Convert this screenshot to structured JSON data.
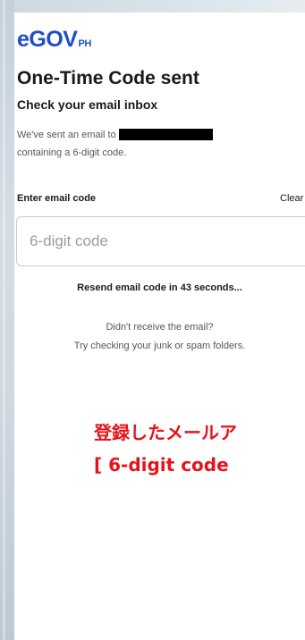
{
  "brand": {
    "logo_main": "eGOV",
    "logo_sub": "PH",
    "color": "#1f4fc4"
  },
  "header": {
    "title": "One-Time Code sent",
    "subtitle": "Check your email inbox"
  },
  "info": {
    "line1": "We've sent an email to",
    "line2": "containing a 6-digit code."
  },
  "form": {
    "label": "Enter email code",
    "clear_label": "Clear",
    "code_placeholder": "6-digit code",
    "code_value": ""
  },
  "resend_text": "Resend email code in 43 seconds...",
  "help": {
    "line1": "Didn't receive the email?",
    "line2": "Try checking your junk or spam folders."
  },
  "annotation": {
    "line1": "登録したメールア",
    "line2": "[ 6-digit code",
    "color": "#e8121b"
  }
}
